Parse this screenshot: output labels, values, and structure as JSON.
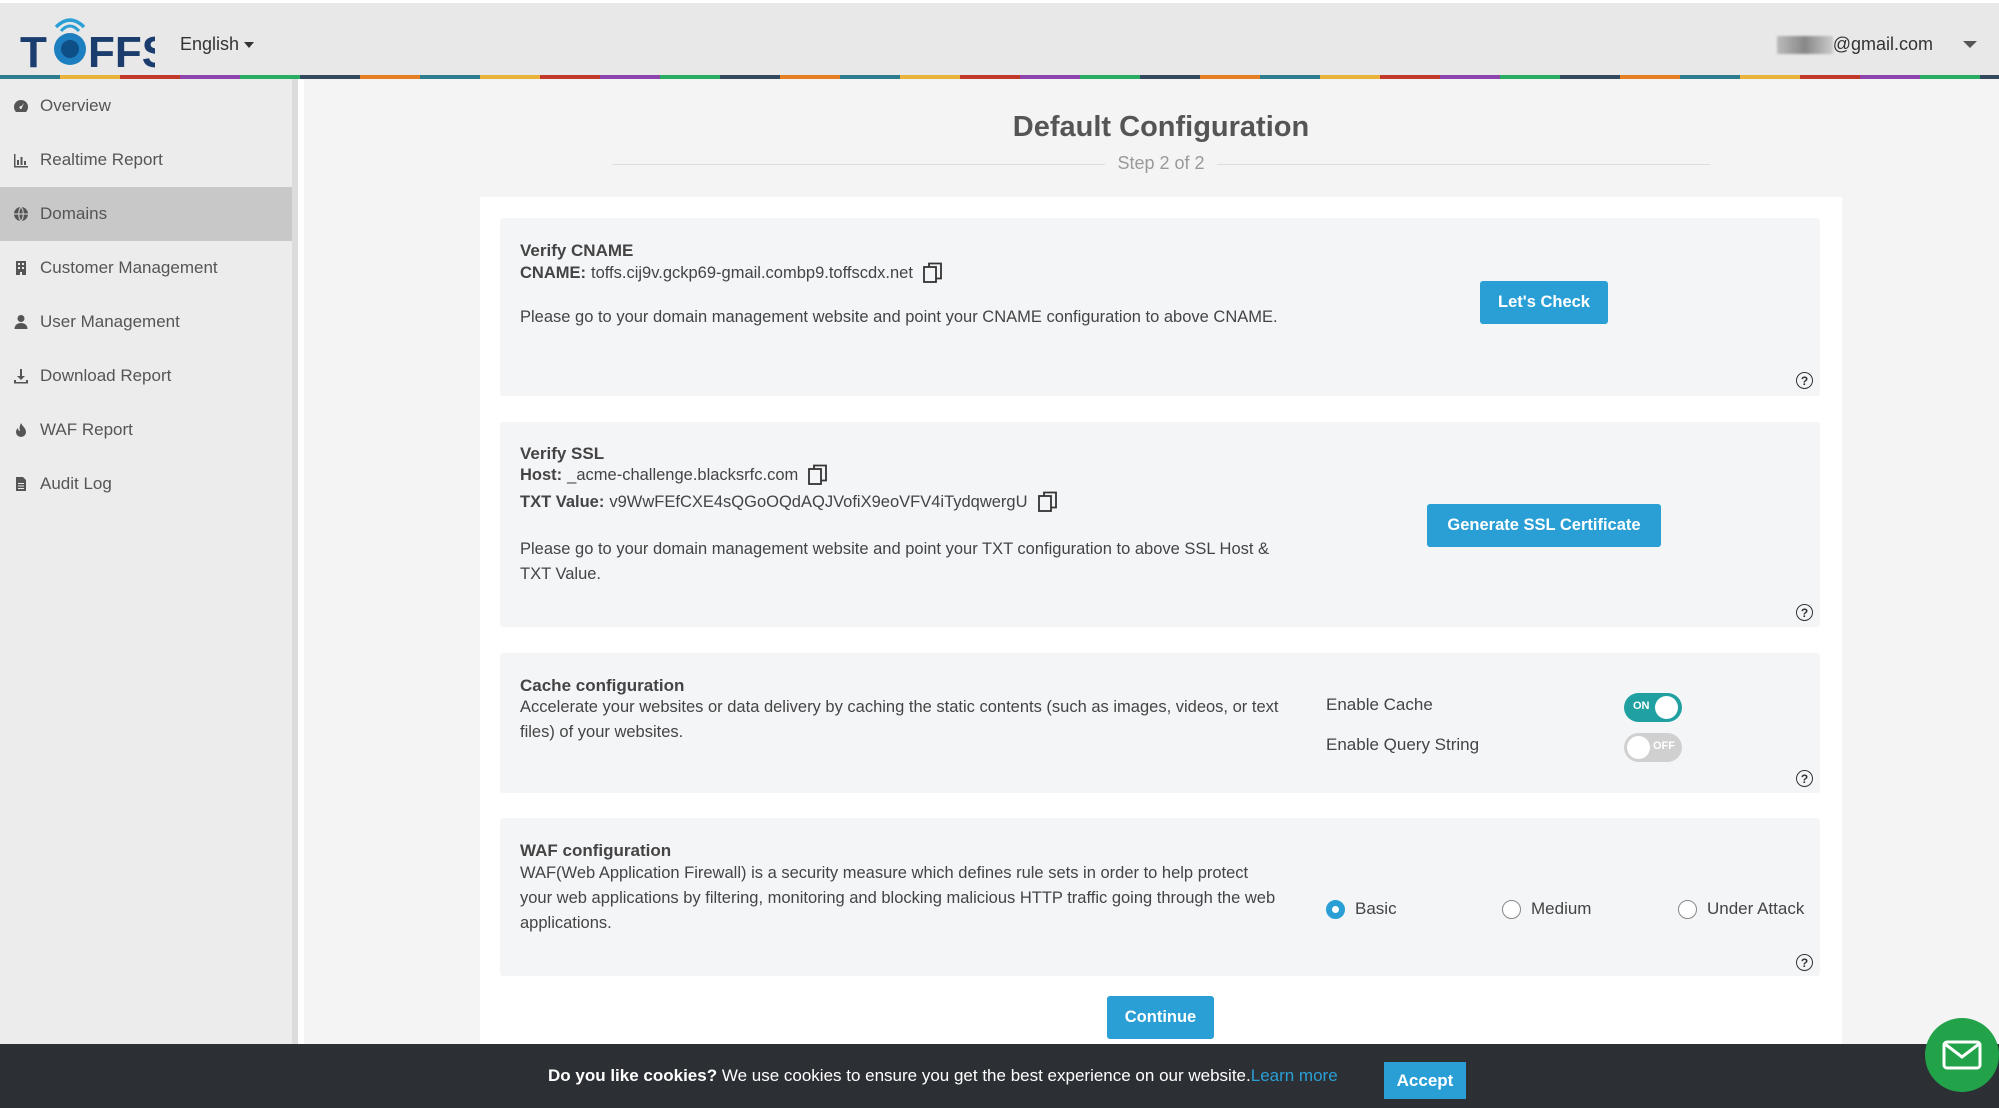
{
  "header": {
    "logo_text": "TOFFS",
    "language": "English",
    "user_email": "@gmail.com"
  },
  "sidebar": {
    "items": [
      {
        "label": "Overview",
        "icon": "dashboard-icon"
      },
      {
        "label": "Realtime Report",
        "icon": "bar-chart-icon"
      },
      {
        "label": "Domains",
        "icon": "globe-icon"
      },
      {
        "label": "Customer Management",
        "icon": "building-icon"
      },
      {
        "label": "User Management",
        "icon": "user-icon"
      },
      {
        "label": "Download Report",
        "icon": "download-icon"
      },
      {
        "label": "WAF Report",
        "icon": "flame-icon"
      },
      {
        "label": "Audit Log",
        "icon": "document-icon"
      }
    ],
    "active_index": 2
  },
  "page": {
    "title": "Default Configuration",
    "step": "Step 2 of 2"
  },
  "cname": {
    "heading": "Verify CNAME",
    "label": "CNAME:",
    "value": "toffs.cij9v.gckp69-gmail.combp9.toffscdx.net",
    "description": "Please go to your domain management website and point your CNAME configuration to above CNAME.",
    "button": "Let's Check"
  },
  "ssl": {
    "heading": "Verify SSL",
    "host_label": "Host:",
    "host_value": "_acme-challenge.blacksrfc.com",
    "txt_label": "TXT Value:",
    "txt_value": "v9WwFEfCXE4sQGoOQdAQJVofiX9eoVFV4iTydqwergU",
    "description": "Please go to your domain management website and point your TXT configuration to above SSL Host & TXT Value.",
    "button": "Generate SSL Certificate"
  },
  "cache": {
    "heading": "Cache configuration",
    "description": "Accelerate your websites or data delivery by caching the static contents (such as images, videos, or text files) of your websites.",
    "enable_cache_label": "Enable Cache",
    "enable_cache_state": "ON",
    "enable_query_label": "Enable Query String",
    "enable_query_state": "OFF"
  },
  "waf": {
    "heading": "WAF configuration",
    "description": "WAF(Web Application Firewall) is a security measure which defines rule sets in order to help protect your web applications by filtering, monitoring and blocking malicious HTTP traffic going through the web applications.",
    "options": [
      "Basic",
      "Medium",
      "Under Attack"
    ],
    "selected": "Basic"
  },
  "continue_button": "Continue",
  "help_glyph": "?",
  "cookie": {
    "question": "Do you like cookies?",
    "text": " We use cookies to ensure you get the best experience on our website.",
    "learn_more": "Learn more",
    "accept": "Accept"
  },
  "colors": {
    "accent": "#2a9fd6",
    "toggle_on": "#20a0a0",
    "fab": "#22a34a"
  }
}
